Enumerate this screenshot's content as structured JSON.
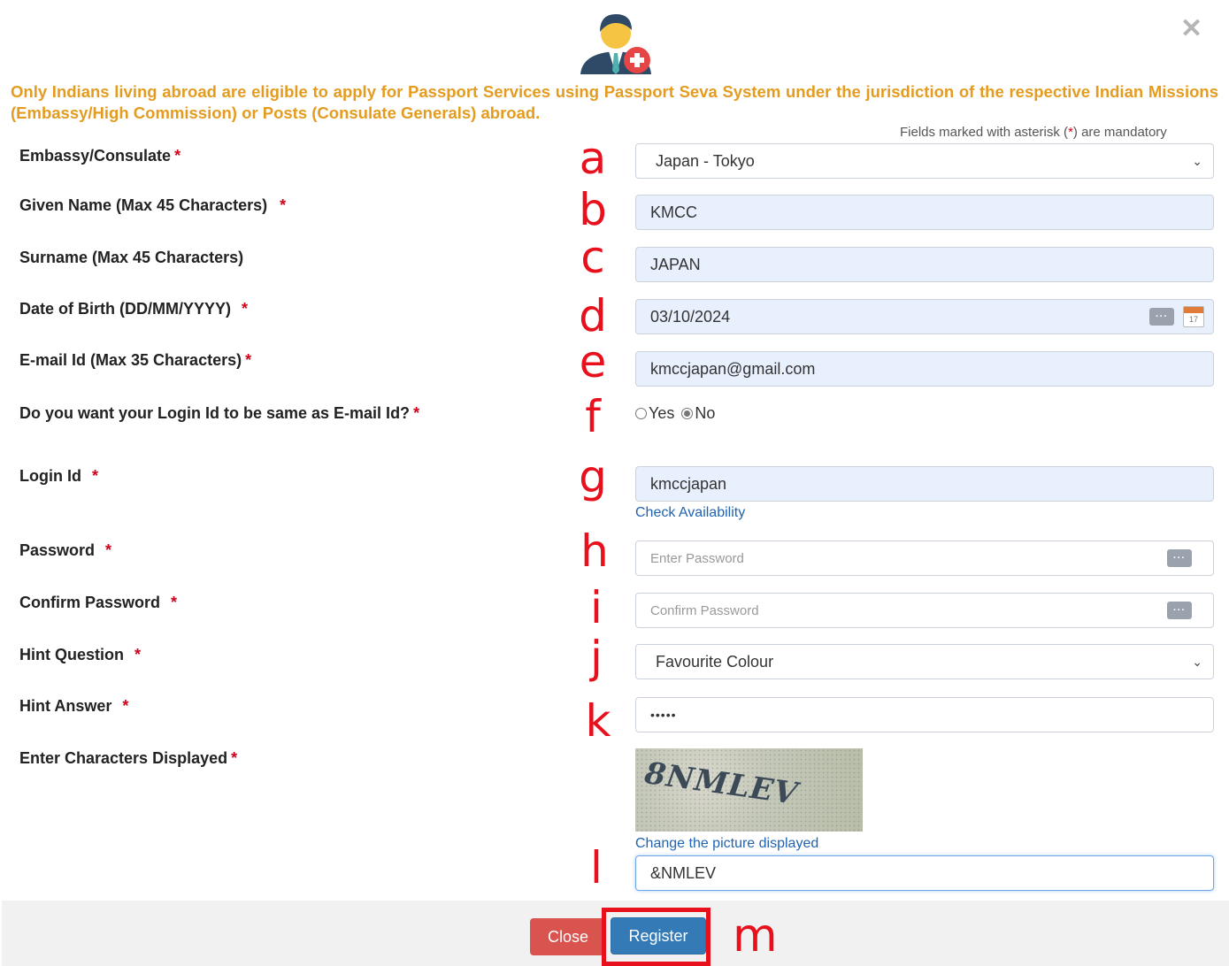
{
  "close_icon": "close-icon",
  "notice": "Only Indians living abroad are eligible to apply for Passport Services using Passport Seva System under the jurisdiction of the respective Indian Missions (Embassy/High Commission) or Posts (Consulate Generals) abroad.",
  "mandatory_note": {
    "before": "Fields marked with asterisk (",
    "star": "*",
    "after": ") are mandatory"
  },
  "required_mark": "*",
  "annotations": [
    "a",
    "b",
    "c",
    "d",
    "e",
    "f",
    "g",
    "h",
    "i",
    "j",
    "k",
    "l",
    "m"
  ],
  "fields": {
    "embassy": {
      "label": "Embassy/Consulate",
      "value": "Japan - Tokyo"
    },
    "given_name": {
      "label": "Given Name (Max 45 Characters)",
      "value": "KMCC"
    },
    "surname": {
      "label": "Surname (Max 45 Characters)",
      "value": "JAPAN"
    },
    "dob": {
      "label": "Date of Birth (DD/MM/YYYY)",
      "value": "03/10/2024",
      "calendar_day": "17"
    },
    "email": {
      "label": "E-mail Id (Max 35 Characters)",
      "value": "kmccjapan@gmail.com"
    },
    "login_same": {
      "label": "Do you want your Login Id to be same as E-mail Id?",
      "yes": "Yes",
      "no": "No",
      "selected": "No"
    },
    "login_id": {
      "label": "Login Id",
      "value": "kmccjapan",
      "check_link": "Check Availability"
    },
    "password": {
      "label": "Password",
      "placeholder": "Enter Password"
    },
    "confirm_password": {
      "label": "Confirm Password",
      "placeholder": "Confirm Password"
    },
    "hint_question": {
      "label": "Hint Question",
      "value": "Favourite Colour"
    },
    "hint_answer": {
      "label": "Hint Answer",
      "value": "•••••"
    },
    "captcha": {
      "label": "Enter Characters Displayed",
      "image_text": "8NMLEV",
      "change_link": "Change the picture displayed",
      "value": "&NMLEV"
    }
  },
  "keyboard_icon_text": "···",
  "buttons": {
    "close": "Close",
    "register": "Register"
  }
}
